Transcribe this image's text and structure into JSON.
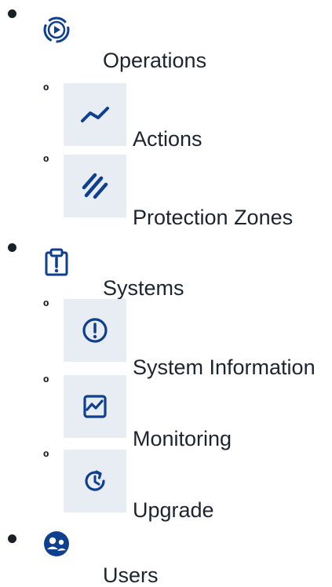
{
  "nav": {
    "operations": {
      "label": "Operations",
      "icon": "operations-cycle-icon",
      "children": [
        {
          "label": "Actions",
          "icon": "activity-line-icon"
        },
        {
          "label": "Protection Zones",
          "icon": "hatched-zone-icon"
        }
      ]
    },
    "systems": {
      "label": "Systems",
      "icon": "clipboard-alert-icon",
      "children": [
        {
          "label": "System Information",
          "icon": "info-circle-icon"
        },
        {
          "label": "Monitoring",
          "icon": "monitoring-chart-icon"
        },
        {
          "label": "Upgrade",
          "icon": "upgrade-clock-icon"
        }
      ]
    },
    "users": {
      "label": "Users",
      "icon": "users-group-icon"
    }
  },
  "colors": {
    "icon": "#0f3f8f",
    "icon_box_bg": "#e8edf3",
    "text": "#1d2430"
  }
}
